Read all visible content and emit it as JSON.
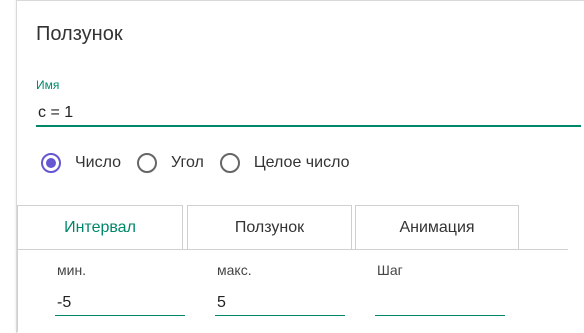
{
  "dialog": {
    "title": "Ползунок"
  },
  "name_field": {
    "label": "Имя",
    "value": "c = 1"
  },
  "type_options": [
    {
      "label": "Число",
      "selected": true
    },
    {
      "label": "Угол",
      "selected": false
    },
    {
      "label": "Целое число",
      "selected": false
    }
  ],
  "tabs": [
    {
      "label": "Интервал",
      "active": true
    },
    {
      "label": "Ползунок",
      "active": false
    },
    {
      "label": "Анимация",
      "active": false
    }
  ],
  "interval": {
    "min_label": "мин.",
    "min_value": "-5",
    "max_label": "макс.",
    "max_value": "5",
    "step_label": "Шаг",
    "step_value": ""
  },
  "colors": {
    "accent": "#00876a",
    "radio": "#6557d2"
  }
}
